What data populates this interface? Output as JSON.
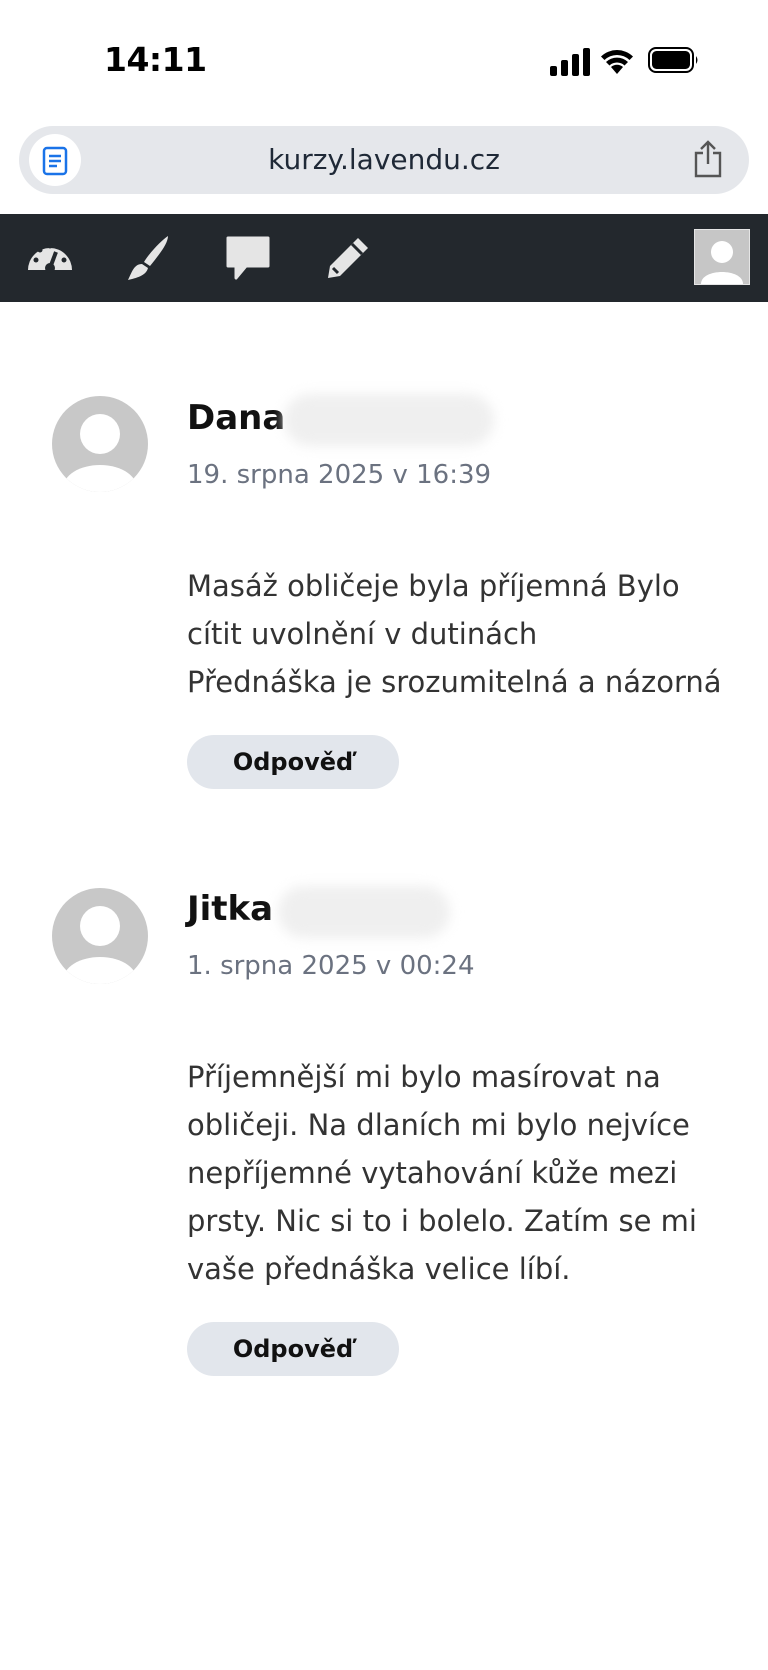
{
  "status_bar": {
    "time": "14:11"
  },
  "browser": {
    "url": "kurzy.lavendu.cz"
  },
  "admin_bar": {
    "icons": [
      "dashboard-icon",
      "customize-brush-icon",
      "comments-icon",
      "edit-pencil-icon",
      "user-avatar"
    ]
  },
  "comments": [
    {
      "author": "Dana",
      "date": "19. srpna 2025 v 16:39",
      "lines": [
        "Masáž obličeje byla příjemná Bylo",
        "cítit uvolnění v dutinách",
        "Přednáška je srozumitelná a názorná"
      ],
      "reply_label": "Odpověď"
    },
    {
      "author": "Jitka",
      "date": "1. srpna 2025 v 00:24",
      "lines": [
        "Příjemnější mi bylo masírovat na",
        "obličeji. Na dlaních mi bylo nejvíce",
        "nepříjemné vytahování kůže mezi",
        "prsty. Nic si to i bolelo. Zatím se mi",
        "vaše přednáška velice líbí."
      ],
      "reply_label": "Odpověď"
    }
  ]
}
